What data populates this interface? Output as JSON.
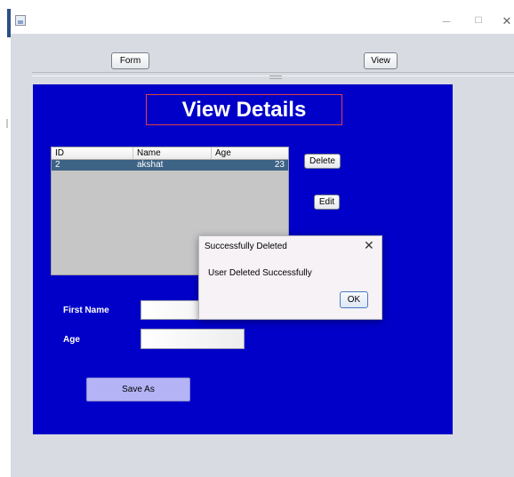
{
  "window": {
    "title": "",
    "min_symbol": "─",
    "max_symbol": "☐",
    "close_symbol": "✕"
  },
  "tabs": {
    "form_label": "Form",
    "view_label": "View"
  },
  "panel": {
    "title": "View Details",
    "background": "#0000c8"
  },
  "table": {
    "columns": [
      "ID",
      "Name",
      "Age"
    ],
    "rows": [
      {
        "id": "2",
        "name": "akshat",
        "age": "23"
      }
    ],
    "selected_row_color": "#3d6385"
  },
  "actions": {
    "delete_label": "Delete",
    "edit_label": "Edit",
    "save_as_label": "Save As"
  },
  "form": {
    "first_name_label": "First Name",
    "first_name_value": "",
    "age_label": "Age",
    "age_value": ""
  },
  "dialog": {
    "title": "Successfully Deleted",
    "message": "User Deleted Successfully",
    "ok_label": "OK",
    "close_symbol": "✕"
  }
}
